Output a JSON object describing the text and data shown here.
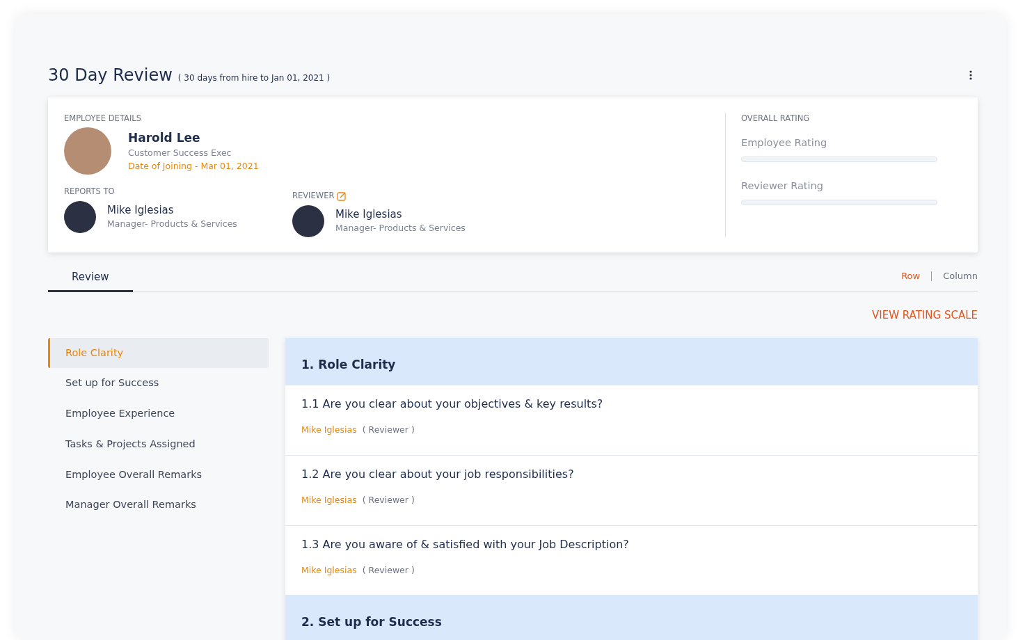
{
  "header": {
    "title": "30 Day Review",
    "subtitle": "( 30 days from hire to Jan 01, 2021 )"
  },
  "employee": {
    "section_label": "EMPLOYEE DETAILS",
    "name": "Harold Lee",
    "role": "Customer Success Exec",
    "joining": "Date of Joining - Mar 01, 2021"
  },
  "reports_to": {
    "section_label": "REPORTS TO",
    "name": "Mike Iglesias",
    "role": "Manager- Products & Services"
  },
  "reviewer": {
    "section_label": "REVIEWER",
    "name": "Mike Iglesias",
    "role": "Manager- Products & Services"
  },
  "overall_rating": {
    "section_label": "OVERALL RATING",
    "ratings": [
      {
        "label": "Employee Rating",
        "level": 0
      },
      {
        "label": "Reviewer Rating",
        "level": 0
      }
    ]
  },
  "tabs": [
    {
      "label": "Review",
      "selected": true
    }
  ],
  "view_toggle": [
    {
      "label": "Row",
      "selected": true
    },
    {
      "label": "Column",
      "selected": false
    }
  ],
  "rating_scale_link": "VIEW RATING SCALE",
  "sidebar": {
    "items": [
      {
        "label": "Role Clarity",
        "selected": true
      },
      {
        "label": "Set up for Success",
        "selected": false
      },
      {
        "label": "Employee Experience",
        "selected": false
      },
      {
        "label": "Tasks & Projects Assigned",
        "selected": false
      },
      {
        "label": "Employee Overall Remarks",
        "selected": false
      },
      {
        "label": "Manager Overall Remarks",
        "selected": false
      }
    ]
  },
  "sections": [
    {
      "title": "1. Role Clarity",
      "questions": [
        {
          "text": "1.1 Are you clear about your objectives & key results?",
          "person": "Mike Iglesias",
          "person_role": "( Reviewer )"
        },
        {
          "text": "1.2 Are you clear about your job responsibilities?",
          "person": "Mike Iglesias",
          "person_role": "( Reviewer )"
        },
        {
          "text": "1.3 Are you aware of & satisfied with your Job Description?",
          "person": "Mike Iglesias",
          "person_role": "( Reviewer )"
        }
      ]
    },
    {
      "title": "2. Set up for Success"
    }
  ]
}
